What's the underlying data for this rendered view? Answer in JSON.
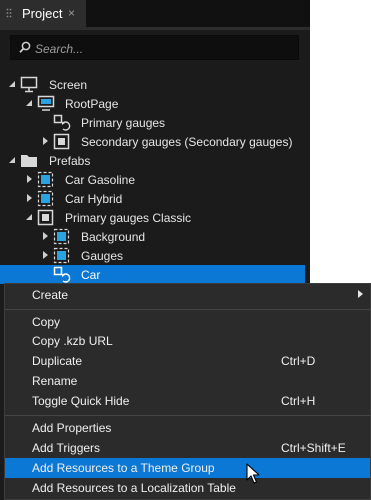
{
  "panel": {
    "tab_title": "Project",
    "close_glyph": "×"
  },
  "search": {
    "placeholder": "Search..."
  },
  "tree": [
    {
      "label": "Screen",
      "icon": "screen-icon"
    },
    {
      "label": "RootPage",
      "icon": "page-icon"
    },
    {
      "label": "Primary gauges",
      "icon": "prefab-placeholder-icon"
    },
    {
      "label": "Secondary gauges (Secondary gauges)",
      "icon": "node-icon"
    },
    {
      "label": "Prefabs",
      "icon": "folder-icon"
    },
    {
      "label": "Car Gasoline",
      "icon": "node-blue-icon"
    },
    {
      "label": "Car Hybrid",
      "icon": "node-blue-icon"
    },
    {
      "label": "Primary gauges Classic",
      "icon": "node-icon"
    },
    {
      "label": "Background",
      "icon": "node-blue-icon"
    },
    {
      "label": "Gauges",
      "icon": "node-blue-icon"
    },
    {
      "label": "Car",
      "icon": "prefab-placeholder-icon",
      "selected": true
    }
  ],
  "menu": {
    "items": [
      {
        "label": "Create",
        "shortcut": ""
      },
      {
        "label": "Copy",
        "shortcut": ""
      },
      {
        "label": "Copy .kzb URL",
        "shortcut": ""
      },
      {
        "label": "Duplicate",
        "shortcut": "Ctrl+D"
      },
      {
        "label": "Rename",
        "shortcut": ""
      },
      {
        "label": "Toggle Quick Hide",
        "shortcut": "Ctrl+H"
      },
      {
        "label": "Add Properties",
        "shortcut": ""
      },
      {
        "label": "Add Triggers",
        "shortcut": "Ctrl+Shift+E"
      },
      {
        "label": "Add Resources to a Theme Group",
        "shortcut": ""
      },
      {
        "label": "Add Resources to a Localization Table",
        "shortcut": ""
      }
    ],
    "highlighted": "Add Resources to a Theme Group"
  },
  "colors": {
    "panel_bg": "#1b1b1b",
    "selection": "#0a78d4",
    "menu_bg": "#2b2b2b",
    "node_blue": "#2aa3e0"
  }
}
